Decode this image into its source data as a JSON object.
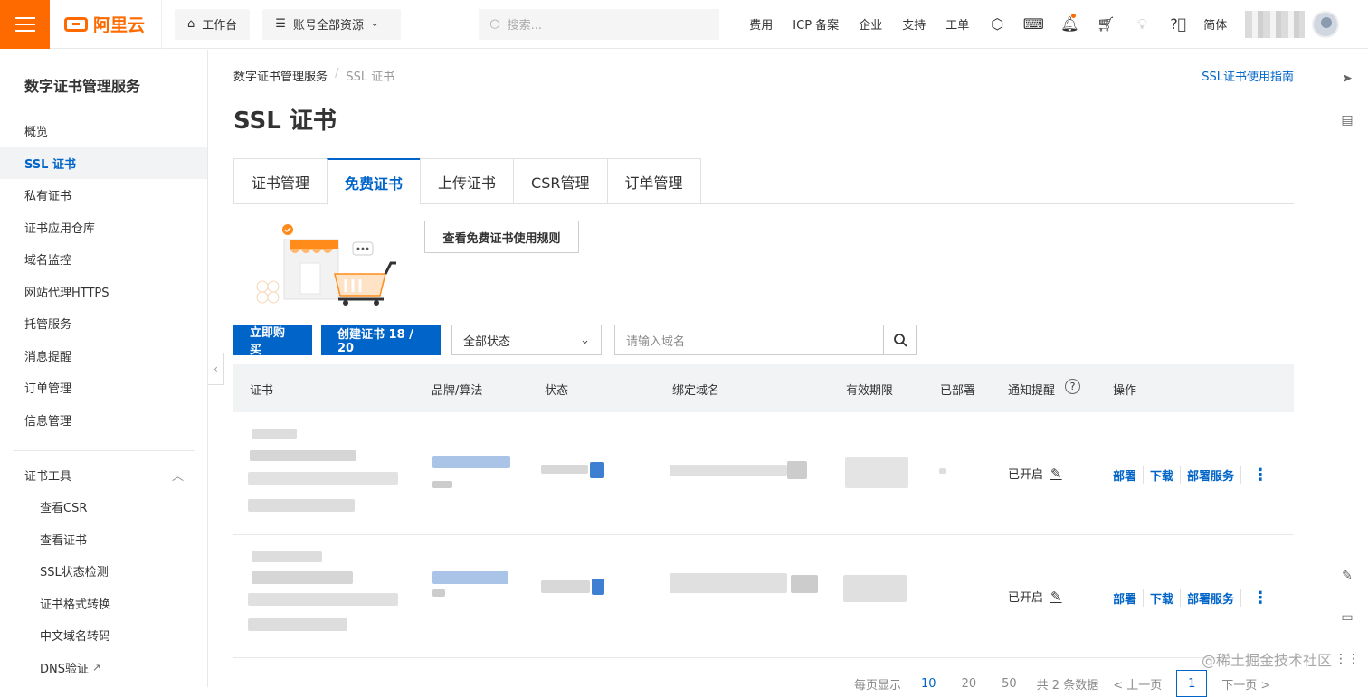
{
  "topbar": {
    "logo_text": "阿里云",
    "workbench": "工作台",
    "resources": "账号全部资源",
    "search_placeholder": "搜索...",
    "nav": [
      "费用",
      "ICP 备案",
      "企业",
      "支持",
      "工单"
    ],
    "lang": "简体"
  },
  "sidebar": {
    "title": "数字证书管理服务",
    "items": [
      "概览",
      "SSL 证书",
      "私有证书",
      "证书应用仓库",
      "域名监控",
      "网站代理HTTPS",
      "托管服务",
      "消息提醒",
      "订单管理",
      "信息管理"
    ],
    "tools_group": "证书工具",
    "tools": [
      "查看CSR",
      "查看证书",
      "SSL状态检测",
      "证书格式转换",
      "中文域名转码",
      "DNS验证"
    ]
  },
  "breadcrumb": {
    "root": "数字证书管理服务",
    "current": "SSL 证书"
  },
  "guide_link": "SSL证书使用指南",
  "page_title": "SSL 证书",
  "tabs": [
    "证书管理",
    "免费证书",
    "上传证书",
    "CSR管理",
    "订单管理"
  ],
  "rules_button": "查看免费证书使用规则",
  "toolbar": {
    "buy": "立即购买",
    "create": "创建证书 18 / 20",
    "status_select": "全部状态",
    "domain_placeholder": "请输入域名"
  },
  "table": {
    "headers": [
      "证书",
      "品牌/算法",
      "状态",
      "绑定域名",
      "有效期限",
      "已部署",
      "通知提醒",
      "操作"
    ],
    "rows": [
      {
        "notify": "已开启",
        "actions": [
          "部署",
          "下载",
          "部署服务"
        ]
      },
      {
        "notify": "已开启",
        "actions": [
          "部署",
          "下载",
          "部署服务"
        ]
      }
    ]
  },
  "pager": {
    "per_page_label": "每页显示",
    "sizes": [
      "10",
      "20",
      "50"
    ],
    "total": "共 2 条数据",
    "prev": "< 上一页",
    "page": "1",
    "next": "下一页 >"
  },
  "watermark": "@稀土掘金技术社区",
  "colors": {
    "brand": "#ff6a00",
    "primary": "#0064c8"
  }
}
